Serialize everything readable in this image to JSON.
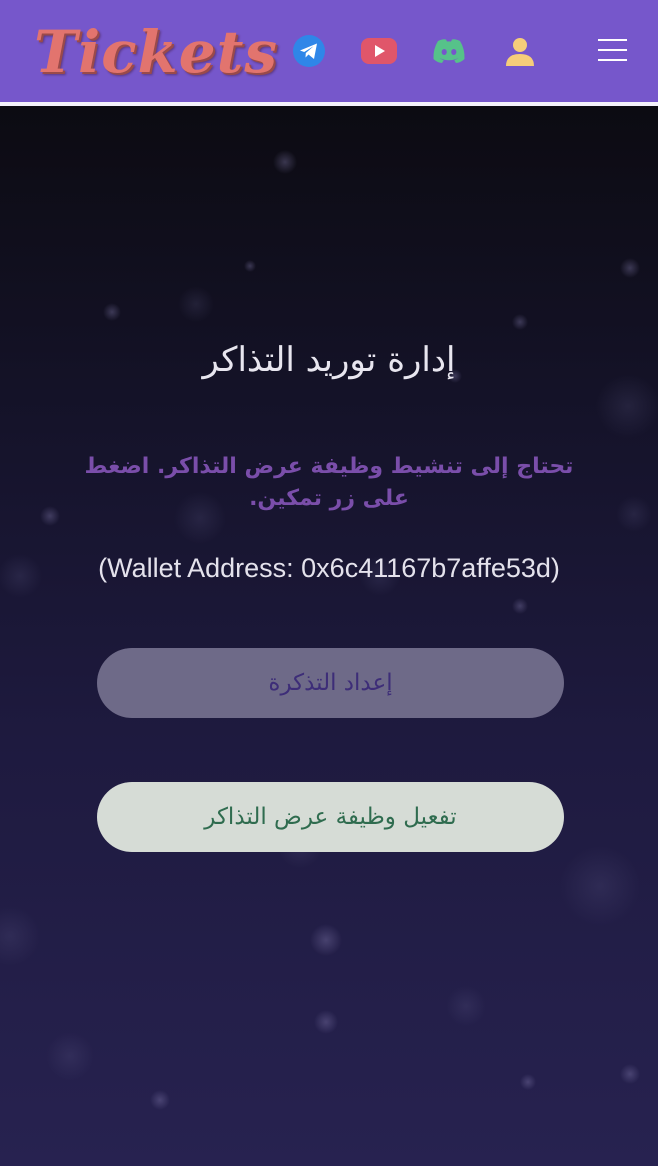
{
  "header": {
    "logo_text": "Tickets",
    "icons": {
      "telegram": "telegram-icon",
      "youtube": "youtube-icon",
      "discord": "discord-icon",
      "user": "user-icon",
      "menu": "hamburger-menu-icon"
    }
  },
  "main": {
    "title": "إدارة توريد التذاكر",
    "notice": "تحتاج إلى تنشيط وظيفة عرض التذاكر. اضغط على زر تمكين.",
    "wallet_text": "(Wallet Address: 0x6c41167b7affe53d)",
    "setup_button_label": "إعداد التذكرة",
    "enable_button_label": "تفعيل وظيفة عرض التذاكر"
  },
  "colors": {
    "header_bg": "#7657cb",
    "logo": "#e2746e",
    "notice": "#7a4eaa",
    "telegram": "#2f86e8",
    "youtube": "#e0566a",
    "discord": "#56c28a",
    "user": "#f6cd7a"
  }
}
